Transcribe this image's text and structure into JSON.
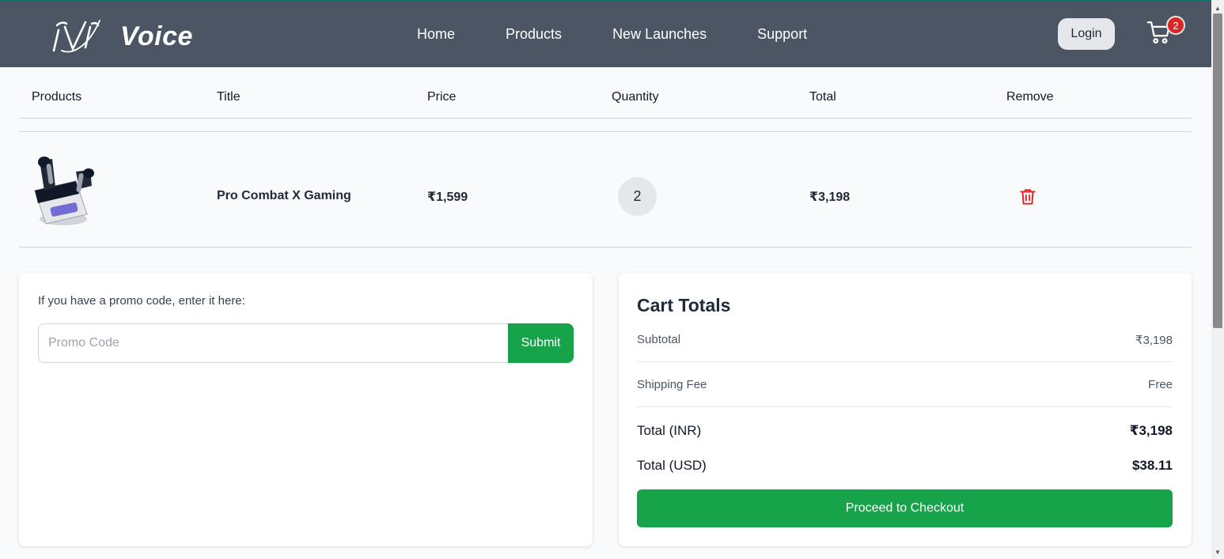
{
  "brand": {
    "name": "Voice",
    "logo_icon": "voice-v-logo"
  },
  "nav": {
    "links": [
      "Home",
      "Products",
      "New Launches",
      "Support"
    ]
  },
  "header": {
    "login_label": "Login",
    "cart_count": "2",
    "cart_icon": "cart-icon"
  },
  "table": {
    "headers": [
      "Products",
      "Title",
      "Price",
      "Quantity",
      "Total",
      "Remove"
    ],
    "rows": [
      {
        "title": "Pro Combat X Gaming",
        "price": "₹1,599",
        "quantity": "2",
        "total": "₹3,198",
        "image": "earbuds-image",
        "remove_icon": "trash-icon"
      }
    ]
  },
  "promo": {
    "prompt": "If you have a promo code, enter it here:",
    "placeholder": "Promo Code",
    "submit_label": "Submit"
  },
  "totals": {
    "title": "Cart Totals",
    "subtotal_label": "Subtotal",
    "subtotal_value": "₹3,198",
    "shipping_label": "Shipping Fee",
    "shipping_value": "Free",
    "total_inr_label": "Total (INR)",
    "total_inr_value": "₹3,198",
    "total_usd_label": "Total (USD)",
    "total_usd_value": "$38.11",
    "checkout_label": "Proceed to Checkout"
  },
  "colors": {
    "navbar": "#4b5563",
    "accent_green": "#16a34a",
    "badge_red": "#dc2626",
    "page_bg": "#f8fafc"
  }
}
